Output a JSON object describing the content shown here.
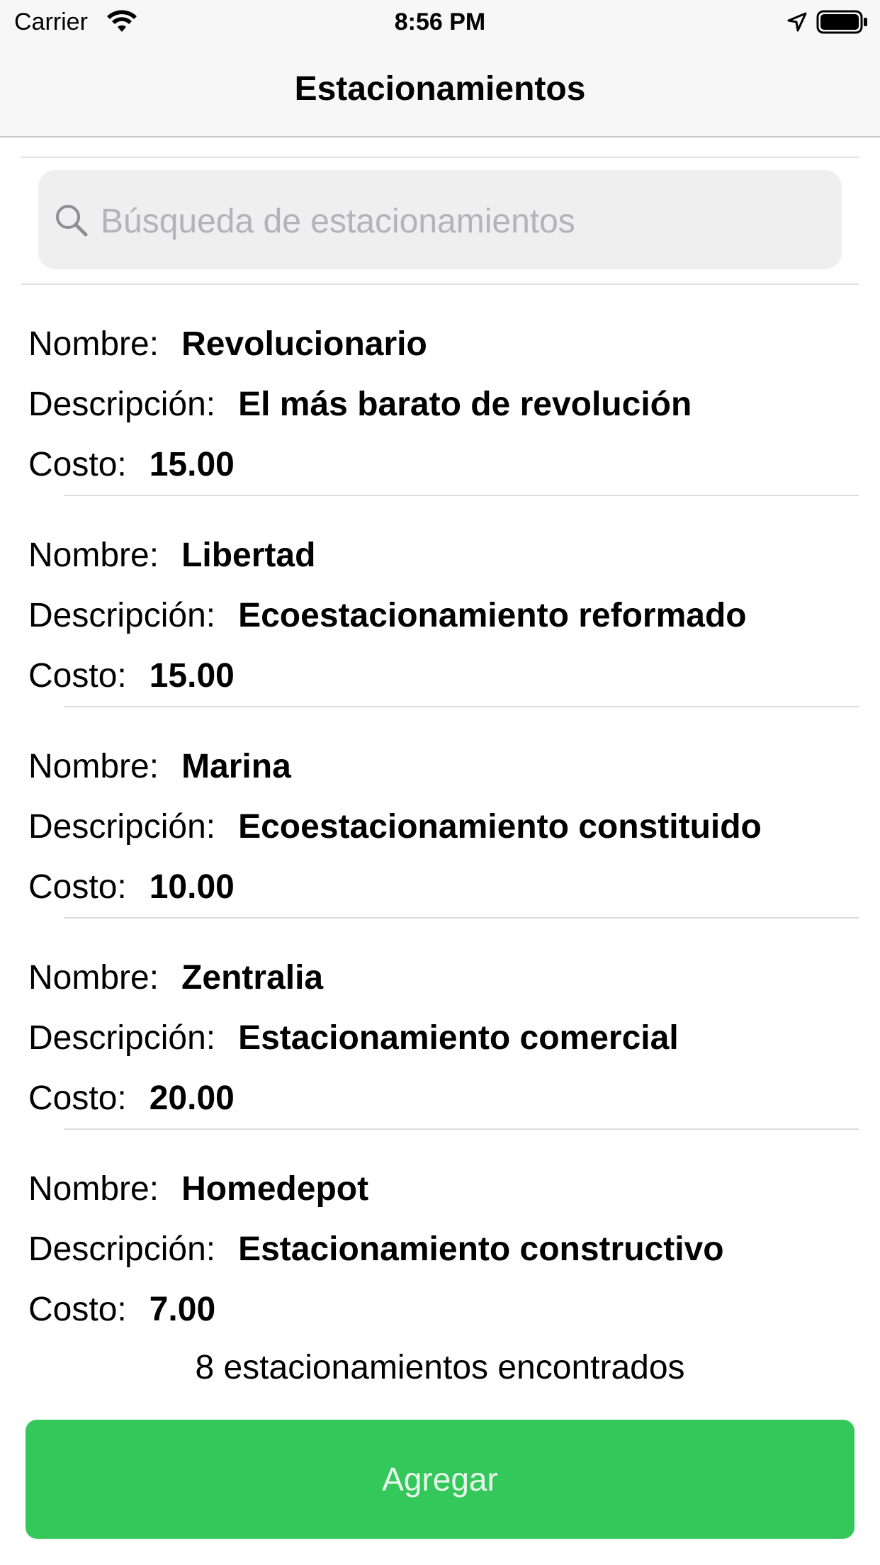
{
  "status_bar": {
    "carrier": "Carrier",
    "time": "8:56 PM",
    "icons": [
      "wifi-icon",
      "location-icon",
      "battery-icon"
    ]
  },
  "nav": {
    "title": "Estacionamientos"
  },
  "search": {
    "placeholder": "Búsqueda de estacionamientos",
    "value": "",
    "icon": "search-icon"
  },
  "parkings": [
    {
      "name_label": "Nombre:",
      "name": "Revolucionario",
      "desc_label": "Descripción:",
      "description": "El más barato de revolución",
      "cost_label": "Costo:",
      "cost": "15.00"
    },
    {
      "name_label": "Nombre:",
      "name": "Libertad",
      "desc_label": "Descripción:",
      "description": "Ecoestacionamiento reformado",
      "cost_label": "Costo:",
      "cost": "15.00"
    },
    {
      "name_label": "Nombre:",
      "name": "Marina",
      "desc_label": "Descripción:",
      "description": "Ecoestacionamiento constituido",
      "cost_label": "Costo:",
      "cost": "10.00"
    },
    {
      "name_label": "Nombre:",
      "name": "Zentralia",
      "desc_label": "Descripción:",
      "description": "Estacionamiento comercial",
      "cost_label": "Costo:",
      "cost": "20.00"
    },
    {
      "name_label": "Nombre:",
      "name": "Homedepot",
      "desc_label": "Descripción:",
      "description": "Estacionamiento constructivo",
      "cost_label": "Costo:",
      "cost": "7.00"
    }
  ],
  "footer": {
    "count_text": "8 estacionamientos encontrados",
    "add_label": "Agregar"
  },
  "colors": {
    "accent_green": "#34c759",
    "nav_background": "#f7f7f7",
    "search_background": "#efeff0"
  }
}
